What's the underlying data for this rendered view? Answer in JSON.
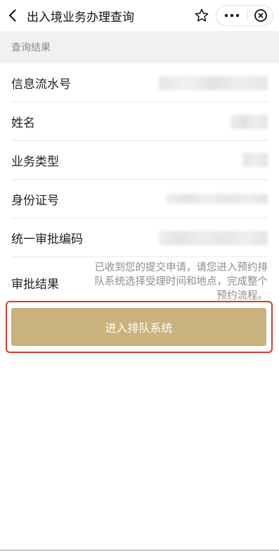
{
  "nav": {
    "title": "出入境业务办理查询",
    "back_icon": "chevron-left-icon",
    "favorite_icon": "star-icon",
    "more_icon": "more-dots-icon",
    "close_icon": "close-circle-icon"
  },
  "section": {
    "title": "查询结果"
  },
  "fields": [
    {
      "label": "信息流水号"
    },
    {
      "label": "姓名"
    },
    {
      "label": "业务类型"
    },
    {
      "label": "身份证号"
    },
    {
      "label": "统一审批编码"
    }
  ],
  "result": {
    "label": "审批结果",
    "text": "已收到您的提交申请，请您进入预约排队系统选择受理时间和地点，完成整个预约流程。"
  },
  "action": {
    "label": "进入排队系统"
  },
  "colors": {
    "button": "#c9b27d",
    "highlight_border": "#d53b30",
    "section_bg": "#f1f1f1",
    "muted_text": "#8c8c8c"
  }
}
